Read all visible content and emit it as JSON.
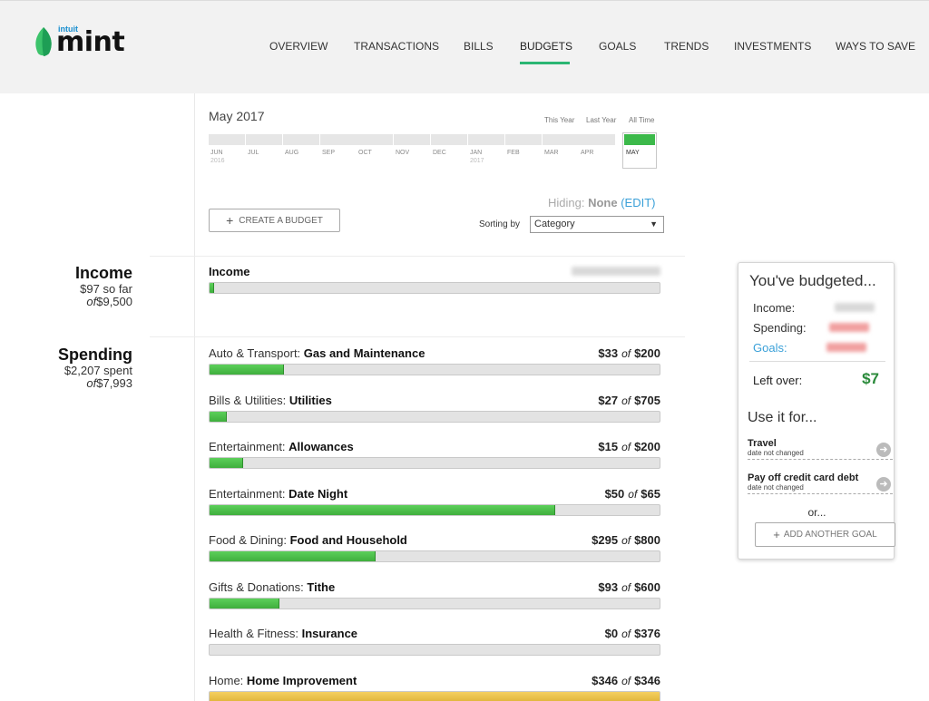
{
  "header": {
    "logo_small": "intuit",
    "logo_text": "mint",
    "nav": [
      {
        "label": "OVERVIEW"
      },
      {
        "label": "TRANSACTIONS"
      },
      {
        "label": "BILLS"
      },
      {
        "label": "BUDGETS"
      },
      {
        "label": "GOALS"
      },
      {
        "label": "TRENDS"
      },
      {
        "label": "INVESTMENTS"
      },
      {
        "label": "WAYS TO SAVE"
      }
    ],
    "active_nav": "BUDGETS",
    "accent_color": "#2bb673"
  },
  "sidebar": {
    "income": {
      "title": "Income",
      "line1": "$97 so far",
      "of": "of",
      "total": "$9,500"
    },
    "spending": {
      "title": "Spending",
      "line1": "$2,207 spent",
      "of": "of",
      "total": "$7,993"
    }
  },
  "period": {
    "title": "May 2017",
    "range_links": [
      "This Year",
      "Last Year",
      "All Time"
    ],
    "months": [
      {
        "m": "JUN",
        "y": "2016"
      },
      {
        "m": "JUL",
        "y": ""
      },
      {
        "m": "AUG",
        "y": ""
      },
      {
        "m": "SEP",
        "y": ""
      },
      {
        "m": "OCT",
        "y": ""
      },
      {
        "m": "NOV",
        "y": ""
      },
      {
        "m": "DEC",
        "y": ""
      },
      {
        "m": "JAN",
        "y": "2017"
      },
      {
        "m": "FEB",
        "y": ""
      },
      {
        "m": "MAR",
        "y": ""
      },
      {
        "m": "APR",
        "y": ""
      },
      {
        "m": "MAY",
        "y": ""
      }
    ],
    "selected_month": "MAY"
  },
  "controls": {
    "hiding_label": "Hiding:",
    "hiding_value": "None",
    "edit_label": "(EDIT)",
    "create_budget": "CREATE A BUDGET",
    "sorting_label": "Sorting by",
    "sorting_value": "Category"
  },
  "income_row": {
    "label": "Income",
    "progress": 0.01
  },
  "budgets": [
    {
      "group": "Auto & Transport: ",
      "name": "Gas and Maintenance",
      "spent": "$33",
      "of": "of",
      "limit": "$200",
      "progress": 0.165,
      "status": "ok"
    },
    {
      "group": "Bills & Utilities: ",
      "name": "Utilities",
      "spent": "$27",
      "of": "of",
      "limit": "$705",
      "progress": 0.038,
      "status": "ok"
    },
    {
      "group": "Entertainment: ",
      "name": "Allowances",
      "spent": "$15",
      "of": "of",
      "limit": "$200",
      "progress": 0.075,
      "status": "ok"
    },
    {
      "group": "Entertainment: ",
      "name": "Date Night",
      "spent": "$50",
      "of": "of",
      "limit": "$65",
      "progress": 0.769,
      "status": "ok"
    },
    {
      "group": "Food & Dining: ",
      "name": "Food and Household",
      "spent": "$295",
      "of": "of",
      "limit": "$800",
      "progress": 0.369,
      "status": "ok"
    },
    {
      "group": "Gifts & Donations: ",
      "name": "Tithe",
      "spent": "$93",
      "of": "of",
      "limit": "$600",
      "progress": 0.155,
      "status": "ok"
    },
    {
      "group": "Health & Fitness: ",
      "name": "Insurance",
      "spent": "$0",
      "of": "of",
      "limit": "$376",
      "progress": 0.0,
      "status": "ok"
    },
    {
      "group": "Home: ",
      "name": "Home Improvement",
      "spent": "$346",
      "of": "of",
      "limit": "$346",
      "progress": 1.0,
      "status": "warn"
    }
  ],
  "card": {
    "title": "You've budgeted...",
    "income_label": "Income:",
    "spending_label": "Spending:",
    "goals_label": "Goals:",
    "leftover_label": "Left over:",
    "leftover_value": "$7",
    "use_it": "Use it for...",
    "goals": [
      {
        "name": "Travel",
        "sub": "date not changed"
      },
      {
        "name": "Pay off credit card debt",
        "sub": "date not changed"
      }
    ],
    "or": "or...",
    "add_goal": "ADD ANOTHER GOAL"
  }
}
